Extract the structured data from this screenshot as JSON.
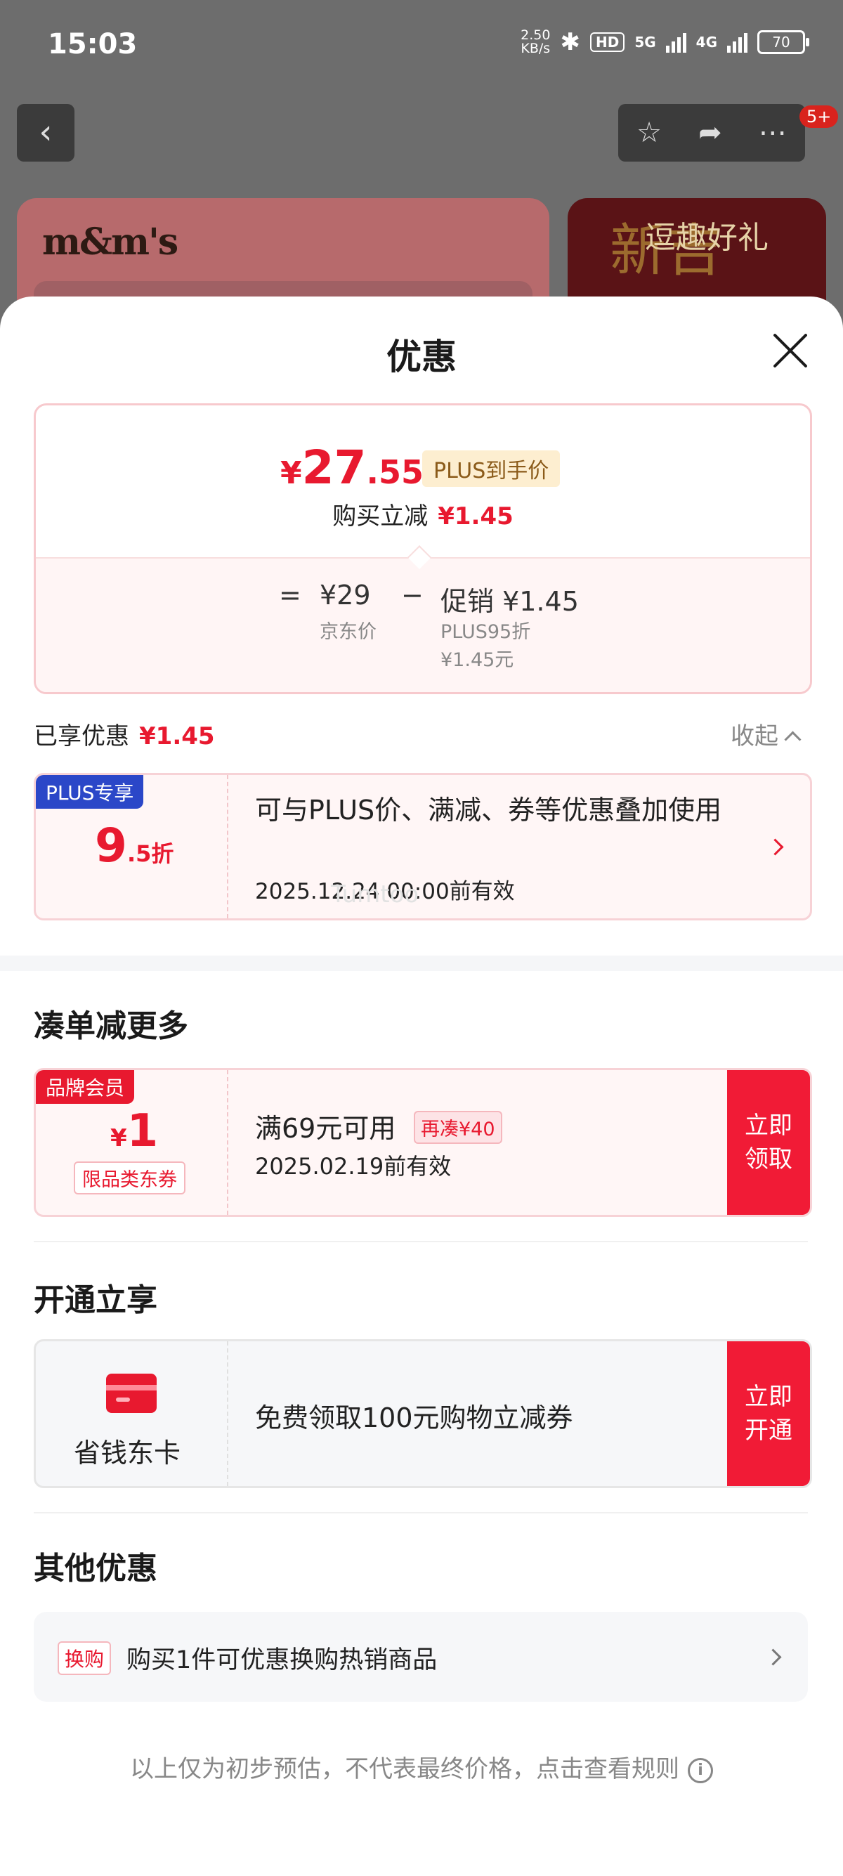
{
  "status_bar": {
    "time": "15:03",
    "speed_value": "2.50",
    "speed_unit": "KB/s",
    "hd": "HD",
    "net1": "5G",
    "net2": "4G",
    "battery": "70"
  },
  "header": {
    "cart_badge": "5+"
  },
  "bg_page": {
    "brand_logo": "m&m's",
    "promo_text": "逗趣好礼",
    "promo_deco": "新吉"
  },
  "sheet": {
    "title": "优惠",
    "price_summary": {
      "currency": "¥",
      "price_int": "27",
      "price_dec": ".55",
      "plus_tag": "PLUS到手价",
      "reduce_label": "购买立减",
      "reduce_amount": "¥1.45",
      "eq": "=",
      "jd_price": "¥29",
      "jd_price_label": "京东价",
      "minus": "−",
      "promo_label": "促销 ¥1.45",
      "promo_detail1": "PLUS95折",
      "promo_detail2": "¥1.45元"
    },
    "enjoyed": {
      "label": "已享优惠",
      "amount": "¥1.45",
      "collapse": "收起"
    },
    "plus_coupon": {
      "ribbon": "PLUS专享",
      "discount_int": "9",
      "discount_dec": ".5折",
      "desc": "可与PLUS价、满减、券等优惠叠加使用",
      "validity": "2025.12.24 00:00前有效",
      "watermark": "Tumtoo"
    },
    "more_section": {
      "title": "凑单减更多",
      "coupon": {
        "ribbon": "品牌会员",
        "currency": "¥",
        "amount": "1",
        "scope": "限品类东券",
        "condition": "满69元可用",
        "extra_tag": "再凑¥40",
        "validity": "2025.02.19前有效",
        "cta": "立即领取"
      }
    },
    "open_section": {
      "title": "开通立享",
      "card": {
        "name": "省钱东卡",
        "desc": "免费领取100元购物立减券",
        "cta": "立即开通"
      }
    },
    "other_section": {
      "title": "其他优惠",
      "tag": "换购",
      "desc": "购买1件可优惠换购热销商品"
    },
    "footer": "以上仅为初步预估，不代表最终价格，点击查看规则",
    "info_icon_text": "i"
  },
  "colors": {
    "accent_red": "#e8192f",
    "cta_red": "#f11b36",
    "plus_blue": "#2b47c8",
    "plus_gold_bg": "#fdeed0"
  }
}
